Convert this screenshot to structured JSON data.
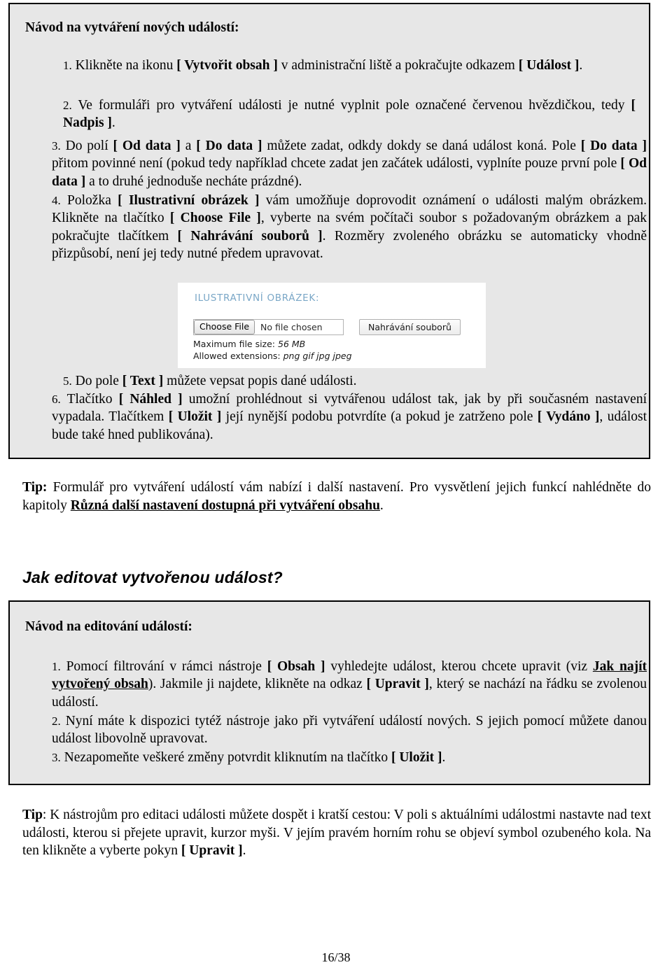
{
  "page": {
    "number": "16/38"
  },
  "box_create": {
    "heading": "Návod na vytváření nových událostí:",
    "items": [
      {
        "num": "1.",
        "html": "Klikněte na ikonu <b>[ Vytvořit obsah ]</b> v administrační liště a pokračujte odkazem <b>[ Událost ]</b>."
      },
      {
        "num": "2.",
        "html": "Ve formuláři pro vytváření události je nutné vyplnit pole označené červenou hvězdičkou, tedy <b>[ Nadpis ]</b>."
      },
      {
        "num": "3.",
        "html": "Do polí <b>[ Od data ]</b> a <b>[ Do data ]</b> můžete zadat, odkdy dokdy se daná událost koná. Pole <b>[ Do data ]</b> přitom povinné není (pokud tedy například chcete zadat jen začátek události, vyplníte pouze první pole <b>[ Od data ]</b> a to druhé jednoduše necháte prázdné)."
      },
      {
        "num": "4.",
        "html": "Položka <b>[ Ilustrativní obrázek ]</b> vám umožňuje doprovodit oznámení o události malým obrázkem. Klikněte na tlačítko <b>[ Choose File ]</b>, vyberte na svém počítači soubor s požadovaným obrázkem a pak pokračujte tlačítkem <b>[ Nahrávání souborů ]</b>. Rozměry zvoleného obrázku se automaticky vhodně přizpůsobí, není jej tedy nutné předem upravovat."
      },
      {
        "num": "5.",
        "html": "Do pole <b>[ Text ]</b> můžete vepsat popis dané události."
      },
      {
        "num": "6.",
        "html": "Tlačítko <b>[ Náhled ]</b> umožní prohlédnout si vytvářenou událost tak, jak by při současném nastavení vypadala. Tlačítkem <b>[ Uložit ]</b> její nynější podobu potvrdíte (a pokud je zatrženo pole <b>[ Vydáno ]</b>, událost bude také hned publikována)."
      }
    ]
  },
  "screenshot": {
    "field_label": "ILUSTRATIVNÍ OBRÁZEK:",
    "choose_file_button": "Choose File",
    "no_file_text": "No file chosen",
    "upload_button": "Nahrávání souborů",
    "max_size_label": "Maximum file size:",
    "max_size_value": "56 MB",
    "extensions_label": "Allowed extensions:",
    "extensions_value": "png gif jpg jpeg"
  },
  "tip_create": {
    "html": "<b>Tip:</b> Formulář pro vytváření událostí vám nabízí i další nastavení. Pro vysvětlení jejich funkcí nahlédněte do kapitoly <b><u>Různá další nastavení dostupná při vytváření obsahu</u></b>."
  },
  "section_edit": {
    "heading": "Jak editovat vytvořenou událost?"
  },
  "box_edit": {
    "heading": "Návod na editování událostí:",
    "items": [
      {
        "num": "1.",
        "html": "Pomocí filtrování v rámci nástroje <b>[ Obsah ]</b> vyhledejte událost, kterou chcete upravit (viz <b><u>Jak najít vytvořený obsah</u></b>). Jakmile ji najdete, klikněte na odkaz <b>[ Upravit ]</b>, který se nachází na řádku se zvolenou událostí."
      },
      {
        "num": "2.",
        "html": "Nyní máte k dispozici tytéž nástroje jako při vytváření událostí nových. S jejich pomocí můžete danou událost libovolně upravovat."
      },
      {
        "num": "3.",
        "html": "Nezapomeňte veškeré změny potvrdit kliknutím na tlačítko <b>[ Uložit ]</b>."
      }
    ]
  },
  "tip_edit": {
    "html": "<b>Tip</b>: K nástrojům pro editaci události můžete dospět i kratší cestou: V poli s aktuálními událostmi nastavte nad text události, kterou si přejete upravit, kurzor myši. V jejím pravém horním rohu se objeví symbol ozubeného kola. Na ten klikněte a vyberte pokyn <b>[ Upravit ]</b>."
  },
  "colors": {
    "panel_background": "#e7e7e7",
    "panel_border": "#000000",
    "field_label_blue": "#7aa7c7",
    "page_background": "#ffffff"
  }
}
